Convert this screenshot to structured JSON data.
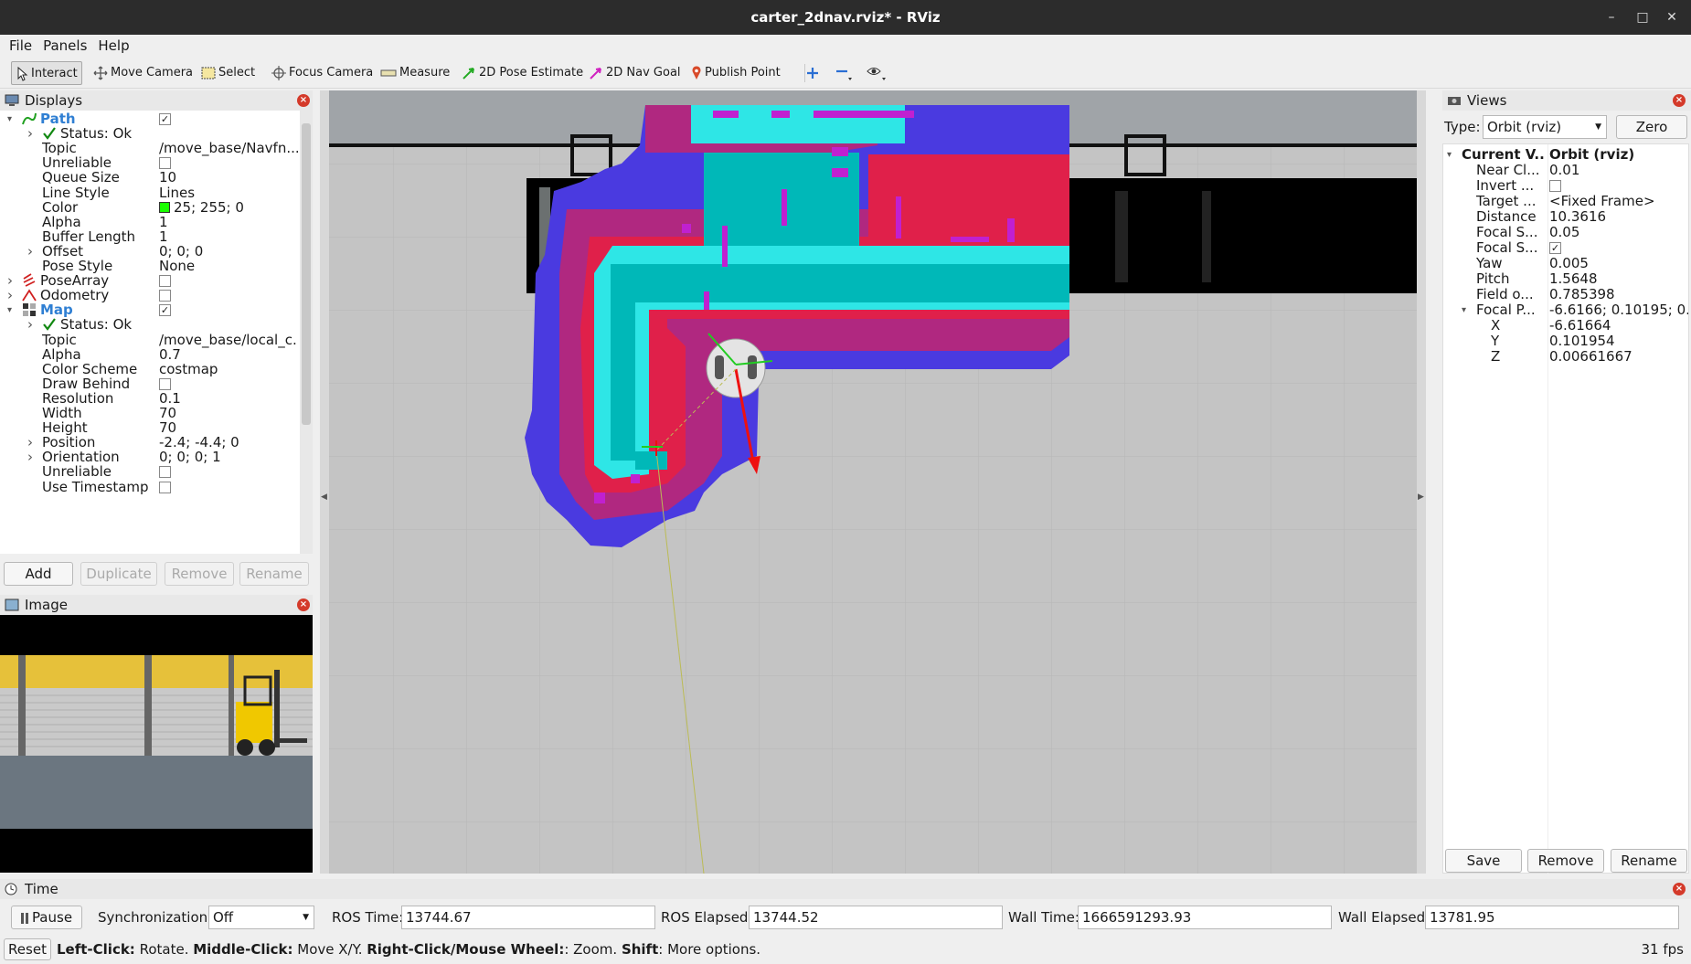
{
  "window": {
    "title": "carter_2dnav.rviz* - RViz"
  },
  "menu": [
    "File",
    "Panels",
    "Help"
  ],
  "toolbar": {
    "tools": [
      {
        "label": "Interact",
        "icon": "cursor-icon"
      },
      {
        "label": "Move Camera",
        "icon": "move-camera-icon"
      },
      {
        "label": "Select",
        "icon": "select-box-icon"
      },
      {
        "label": "Focus Camera",
        "icon": "focus-target-icon"
      },
      {
        "label": "Measure",
        "icon": "ruler-icon"
      },
      {
        "label": "2D Pose Estimate",
        "icon": "green-arrow-icon"
      },
      {
        "label": "2D Nav Goal",
        "icon": "magenta-arrow-icon"
      },
      {
        "label": "Publish Point",
        "icon": "map-pin-icon"
      }
    ],
    "extra_icons": [
      "plus-icon",
      "minus-icon",
      "eye-icon"
    ]
  },
  "displays": {
    "title": "Displays",
    "rows": [
      {
        "label": "Path",
        "value": "",
        "check": "checked",
        "indent": 0,
        "arrow": "open",
        "icon": "path-icon",
        "bold": true
      },
      {
        "label": "Status: Ok",
        "value": "",
        "indent": 1,
        "arrow": "closed",
        "icon": "check-icon"
      },
      {
        "label": "Topic",
        "value": "/move_base/Navfn...",
        "indent": 1
      },
      {
        "label": "Unreliable",
        "value": "",
        "check": "unchecked",
        "indent": 1
      },
      {
        "label": "Queue Size",
        "value": "10",
        "indent": 1
      },
      {
        "label": "Line Style",
        "value": "Lines",
        "indent": 1
      },
      {
        "label": "Color",
        "value": "25; 255; 0",
        "indent": 1,
        "swatch": "#19ff00"
      },
      {
        "label": "Alpha",
        "value": "1",
        "indent": 1
      },
      {
        "label": "Buffer Length",
        "value": "1",
        "indent": 1
      },
      {
        "label": "Offset",
        "value": "0; 0; 0",
        "indent": 1,
        "arrow": "closed"
      },
      {
        "label": "Pose Style",
        "value": "None",
        "indent": 1
      },
      {
        "label": "PoseArray",
        "value": "",
        "check": "unchecked",
        "indent": 0,
        "arrow": "closed",
        "icon": "posearray-icon"
      },
      {
        "label": "Odometry",
        "value": "",
        "check": "unchecked",
        "indent": 0,
        "arrow": "closed",
        "icon": "odometry-icon"
      },
      {
        "label": "Map",
        "value": "",
        "check": "checked",
        "indent": 0,
        "arrow": "open",
        "icon": "map-icon",
        "bold": true
      },
      {
        "label": "Status: Ok",
        "value": "",
        "indent": 1,
        "arrow": "closed",
        "icon": "check-icon"
      },
      {
        "label": "Topic",
        "value": "/move_base/local_c...",
        "indent": 1
      },
      {
        "label": "Alpha",
        "value": "0.7",
        "indent": 1
      },
      {
        "label": "Color Scheme",
        "value": "costmap",
        "indent": 1
      },
      {
        "label": "Draw Behind",
        "value": "",
        "check": "unchecked",
        "indent": 1
      },
      {
        "label": "Resolution",
        "value": "0.1",
        "indent": 1
      },
      {
        "label": "Width",
        "value": "70",
        "indent": 1
      },
      {
        "label": "Height",
        "value": "70",
        "indent": 1
      },
      {
        "label": "Position",
        "value": "-2.4; -4.4; 0",
        "indent": 1,
        "arrow": "closed"
      },
      {
        "label": "Orientation",
        "value": "0; 0; 0; 1",
        "indent": 1,
        "arrow": "closed"
      },
      {
        "label": "Unreliable",
        "value": "",
        "check": "unchecked",
        "indent": 1
      },
      {
        "label": "Use Timestamp",
        "value": "",
        "check": "unchecked",
        "indent": 1
      }
    ],
    "buttons": [
      "Add",
      "Duplicate",
      "Remove",
      "Rename"
    ]
  },
  "image_panel": {
    "title": "Image"
  },
  "views": {
    "title": "Views",
    "type_label": "Type:",
    "type_value": "Orbit (rviz)",
    "zero_button": "Zero",
    "rows": [
      {
        "label": "Current V...",
        "value": "Orbit (rviz)",
        "indent": 0,
        "arrow": "open",
        "bold": true
      },
      {
        "label": "Near Cl...",
        "value": "0.01",
        "indent": 1
      },
      {
        "label": "Invert ...",
        "value": "",
        "check": "unchecked",
        "indent": 1
      },
      {
        "label": "Target ...",
        "value": "<Fixed Frame>",
        "indent": 1
      },
      {
        "label": "Distance",
        "value": "10.3616",
        "indent": 1
      },
      {
        "label": "Focal S...",
        "value": "0.05",
        "indent": 1
      },
      {
        "label": "Focal S...",
        "value": "",
        "check": "checked",
        "indent": 1
      },
      {
        "label": "Yaw",
        "value": "0.005",
        "indent": 1
      },
      {
        "label": "Pitch",
        "value": "1.5648",
        "indent": 1
      },
      {
        "label": "Field o...",
        "value": "0.785398",
        "indent": 1
      },
      {
        "label": "Focal P...",
        "value": "-6.6166; 0.10195; 0....",
        "indent": 1,
        "arrow": "open"
      },
      {
        "label": "X",
        "value": "-6.61664",
        "indent": 2
      },
      {
        "label": "Y",
        "value": "0.101954",
        "indent": 2
      },
      {
        "label": "Z",
        "value": "0.00661667",
        "indent": 2
      }
    ],
    "buttons": [
      "Save",
      "Remove",
      "Rename"
    ]
  },
  "time": {
    "title": "Time",
    "pause": "Pause",
    "sync_label": "Synchronization:",
    "sync_value": "Off",
    "ros_time_label": "ROS Time:",
    "ros_time": "13744.67",
    "ros_elapsed_label": "ROS Elapsed:",
    "ros_elapsed": "13744.52",
    "wall_time_label": "Wall Time:",
    "wall_time": "1666591293.93",
    "wall_elapsed_label": "Wall Elapsed:",
    "wall_elapsed": "13781.95"
  },
  "status": {
    "reset": "Reset",
    "hint": [
      {
        "b": "Left-Click:",
        "t": " Rotate. "
      },
      {
        "b": "Middle-Click:",
        "t": " Move X/Y. "
      },
      {
        "b": "Right-Click/Mouse Wheel:",
        "t": ": Zoom. "
      },
      {
        "b": "Shift",
        "t": ": More options."
      }
    ],
    "fps": "31 fps"
  },
  "colors": {
    "selection": "#2f7fd3",
    "costmap_cyan": "#2ee6e6",
    "costmap_teal": "#00b8b8",
    "costmap_magenta": "#c020d0",
    "costmap_red": "#e0204a",
    "costmap_blue": "#4a3ae0",
    "grid_bg": "#c4c4c4"
  }
}
